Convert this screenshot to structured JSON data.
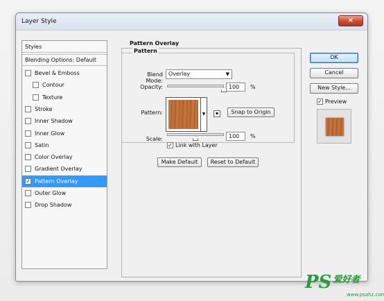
{
  "window": {
    "title": "Layer Style",
    "close_symbol": "×"
  },
  "left_panel": {
    "header": "Styles",
    "blending_options": "Blending Options: Default",
    "items": [
      {
        "label": "Bevel & Emboss",
        "checked": false,
        "indent": false
      },
      {
        "label": "Contour",
        "checked": false,
        "indent": true
      },
      {
        "label": "Texture",
        "checked": false,
        "indent": true
      },
      {
        "label": "Stroke",
        "checked": false,
        "indent": false
      },
      {
        "label": "Inner Shadow",
        "checked": false,
        "indent": false
      },
      {
        "label": "Inner Glow",
        "checked": false,
        "indent": false
      },
      {
        "label": "Satin",
        "checked": false,
        "indent": false
      },
      {
        "label": "Color Overlay",
        "checked": false,
        "indent": false
      },
      {
        "label": "Gradient Overlay",
        "checked": false,
        "indent": false
      },
      {
        "label": "Pattern Overlay",
        "checked": true,
        "indent": false,
        "selected": true
      },
      {
        "label": "Outer Glow",
        "checked": false,
        "indent": false
      },
      {
        "label": "Drop Shadow",
        "checked": false,
        "indent": false
      }
    ]
  },
  "pattern_overlay": {
    "group_title": "Pattern Overlay",
    "sub_title": "Pattern",
    "blend_mode_label": "Blend Mode:",
    "blend_mode_value": "Overlay",
    "opacity_label": "Opacity:",
    "opacity_value": "100",
    "opacity_fraction": 1.0,
    "percent": "%",
    "pattern_label": "Pattern:",
    "snap_button": "Snap to Origin",
    "scale_label": "Scale:",
    "scale_value": "100",
    "scale_fraction": 0.5,
    "link_label": "Link with Layer",
    "link_checked": true,
    "make_default": "Make Default",
    "reset_default": "Reset to Default",
    "pattern_color": "#b96a34"
  },
  "right_panel": {
    "ok": "OK",
    "cancel": "Cancel",
    "new_style": "New Style...",
    "preview_label": "Preview",
    "preview_checked": true
  },
  "watermark": {
    "brand": "PS",
    "cn": "爱好者",
    "url": "www.psahz.com"
  }
}
